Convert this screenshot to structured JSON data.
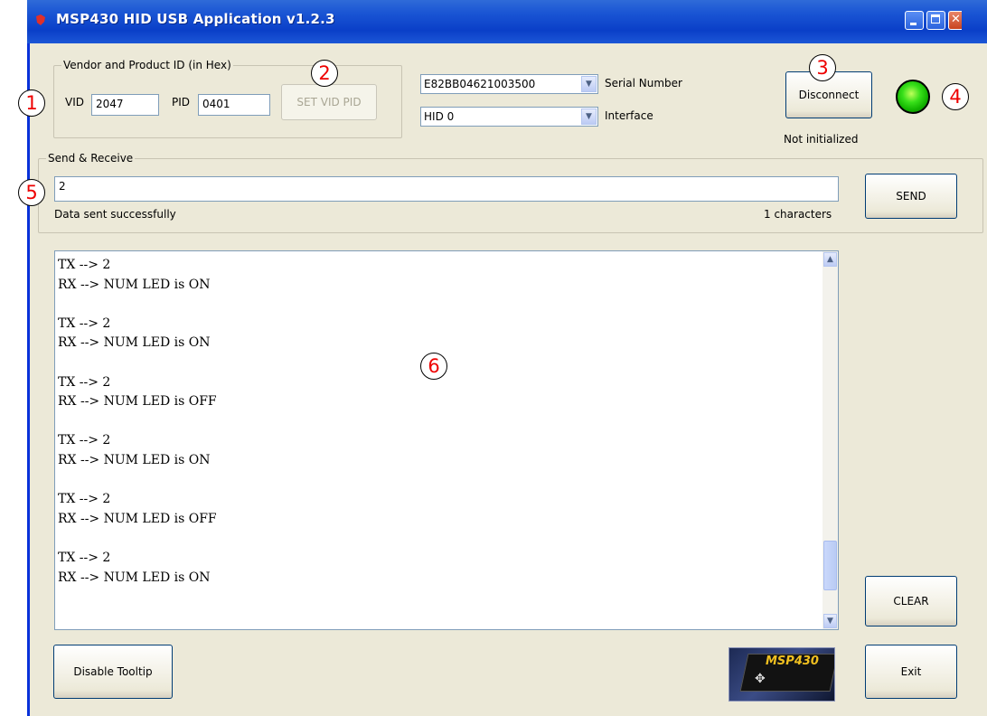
{
  "window": {
    "title": "MSP430 HID USB Application v1.2.3"
  },
  "vendor_group": {
    "legend": "Vendor and Product ID (in Hex)",
    "vid_label": "VID",
    "vid_value": "2047",
    "pid_label": "PID",
    "pid_value": "0401",
    "set_button": "SET VID PID"
  },
  "device": {
    "serial_value": "E82BB04621003500",
    "serial_label": "Serial Number",
    "interface_value": "HID 0",
    "interface_label": "Interface"
  },
  "connection": {
    "button_label": "Disconnect",
    "status_text": "Not initialized",
    "led_color": "#22cc11"
  },
  "send_receive": {
    "legend": "Send & Receive",
    "input_value": "2",
    "status_text": "Data sent successfully",
    "char_count": "1 characters",
    "send_button": "SEND"
  },
  "log": {
    "lines": [
      "TX --> 2",
      "RX --> NUM LED is ON",
      "",
      "TX --> 2",
      "RX --> NUM LED is ON",
      "",
      "TX --> 2",
      "RX --> NUM LED is OFF",
      "",
      "TX --> 2",
      "RX --> NUM LED is ON",
      "",
      "TX --> 2",
      "RX --> NUM LED is OFF",
      "",
      "TX --> 2",
      "RX --> NUM LED is ON"
    ],
    "scroll_position": 0.92
  },
  "buttons": {
    "clear": "CLEAR",
    "exit": "Exit",
    "disable_tooltip": "Disable Tooltip"
  },
  "logo": {
    "text": "MSP430"
  },
  "callouts": [
    "1",
    "2",
    "3",
    "4",
    "5",
    "6"
  ]
}
